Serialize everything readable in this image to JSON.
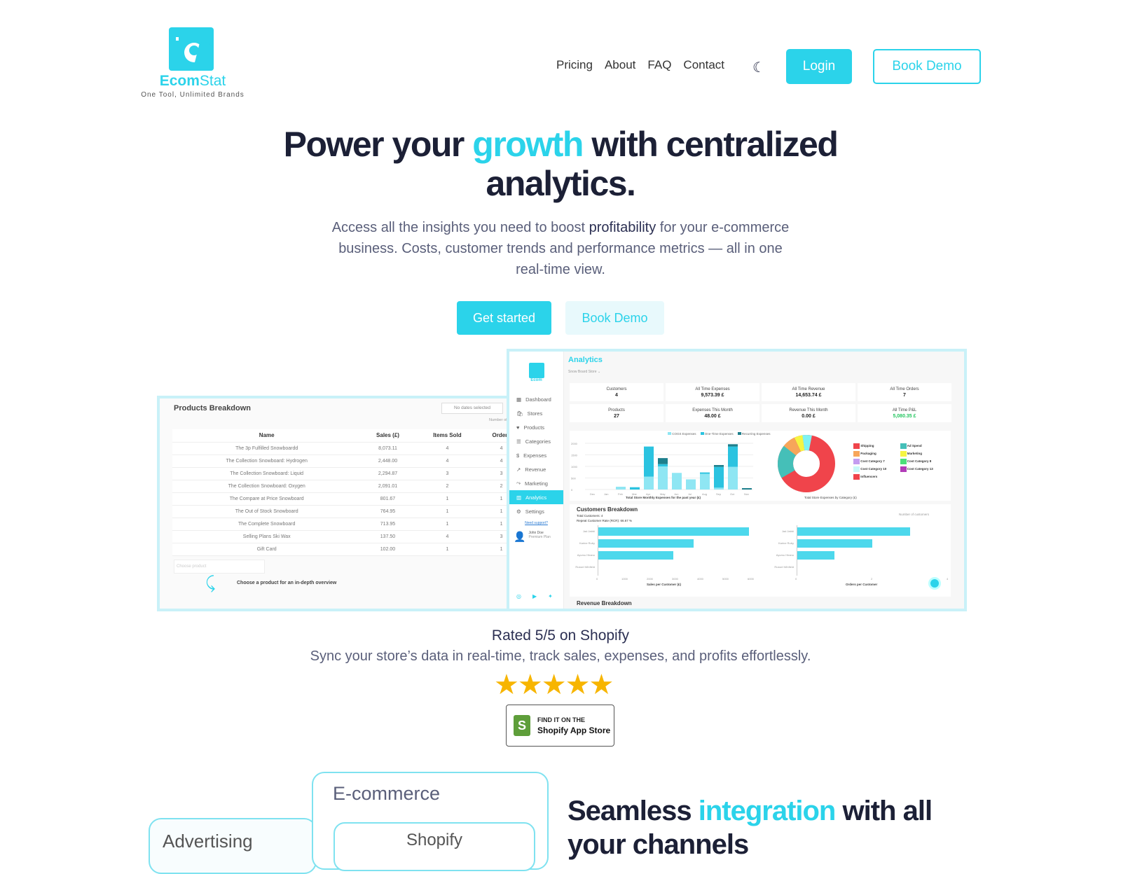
{
  "brand": {
    "name_a": "Ecom",
    "name_b": "Stat",
    "tagline": "One Tool, Unlimited Brands"
  },
  "nav": {
    "items": [
      "Pricing",
      "About",
      "FAQ",
      "Contact"
    ],
    "theme_icon": "moon-icon",
    "login": "Login",
    "book_demo": "Book Demo"
  },
  "hero": {
    "title_a": "Power your ",
    "title_accent": "growth",
    "title_b": " with centralized analytics.",
    "lead_a": "Access all the insights you need to boost ",
    "lead_bold": "profitability",
    "lead_b": " for your e-commerce business. Costs, customer trends and performance metrics — all in one real-time view.",
    "cta_primary": "Get started",
    "cta_secondary": "Book Demo"
  },
  "products": {
    "title": "Products Breakdown",
    "date_filter": "No dates selected",
    "number_of": "Number of",
    "columns": [
      "Name",
      "Sales (£)",
      "Items Sold",
      "Orders"
    ],
    "rows": [
      [
        "The 3p Fulfilled Snowboardd",
        "8,073.11",
        "4",
        "4"
      ],
      [
        "The Collection Snowboard: Hydrogen",
        "2,448.00",
        "4",
        "4"
      ],
      [
        "The Collection Snowboard: Liquid",
        "2,294.87",
        "3",
        "3"
      ],
      [
        "The Collection Snowboard: Oxygen",
        "2,091.01",
        "2",
        "2"
      ],
      [
        "The Compare at Price Snowboard",
        "801.67",
        "1",
        "1"
      ],
      [
        "The Out of Stock Snowboard",
        "764.95",
        "1",
        "1"
      ],
      [
        "The Complete Snowboard",
        "713.95",
        "1",
        "1"
      ],
      [
        "Selling Plans Ski Wax",
        "137.50",
        "4",
        "3"
      ],
      [
        "Gift Card",
        "102.00",
        "1",
        "1"
      ]
    ],
    "choose_placeholder": "Choose product",
    "hint": "Choose a product for an in-depth overview"
  },
  "analytics": {
    "title": "Analytics",
    "store": "Snow Board Store",
    "sidebar": [
      "Dashboard",
      "Stores",
      "Products",
      "Categories",
      "Expenses",
      "Revenue",
      "Marketing",
      "Analytics",
      "Settings"
    ],
    "support": "Need support?",
    "user": "John Doe",
    "user_role": "Premium Plan",
    "cards": [
      [
        "Customers",
        "4"
      ],
      [
        "All Time Expenses",
        "9,573.39 £"
      ],
      [
        "All Time Revenue",
        "14,653.74 £"
      ],
      [
        "All Time Orders",
        "7"
      ],
      [
        "Products",
        "27"
      ],
      [
        "Expenses This Month",
        "48.00 £"
      ],
      [
        "Revenue This Month",
        "0.00 £"
      ],
      [
        "All Time P&L",
        "5,080.35 £"
      ]
    ],
    "pnl_color": "#22c55e",
    "bar_legend": [
      "COGS Expenses",
      "One-Time Expenses",
      "Recurring Expenses"
    ],
    "bar_caption": "Total Store Monthly Expenses for the past year (£)",
    "months": [
      "Dec",
      "Jan",
      "Feb",
      "Mar",
      "Apr",
      "May",
      "Jun",
      "Jul",
      "Aug",
      "Sep",
      "Oct",
      "Nov"
    ],
    "cogs": [
      0,
      0,
      120,
      0,
      560,
      1000,
      720,
      440,
      680,
      80,
      980,
      0
    ],
    "onetime": [
      0,
      0,
      0,
      100,
      1300,
      100,
      0,
      0,
      60,
      900,
      880,
      0
    ],
    "recurring": [
      0,
      0,
      0,
      0,
      0,
      260,
      0,
      0,
      0,
      80,
      100,
      60
    ],
    "donut_caption": "Total Store Expenses by Category (£)",
    "donut_legend": [
      [
        "Shipping",
        "#f0444b"
      ],
      [
        "Ad Spend",
        "#45bfb8"
      ],
      [
        "Packaging",
        "#f7a65a"
      ],
      [
        "Marketing",
        "#f5f542"
      ],
      [
        "Cost Category 7",
        "#c49cf0"
      ],
      [
        "Cost Category 8",
        "#4be07a"
      ],
      [
        "Cost Category 10",
        "#c9f8f8"
      ],
      [
        "Cost Category 13",
        "#b23cb8"
      ],
      [
        "Influencers",
        "#f0444b"
      ]
    ],
    "customers_title": "Customers Breakdown",
    "total_customers": "Total Customers: 4",
    "rcr": "Repeat Customer Rate (RCR): 66.67 %",
    "sort_label": "Number of customers",
    "customer_names": [
      "Jad Jabbi",
      "Karine Ruby",
      "Ayumu Hirano",
      "Russel Winfield"
    ],
    "sales_per_customer": [
      6000,
      3800,
      3000,
      0
    ],
    "sales_axis": "Sales per Customer (£)",
    "orders_per_customer": [
      3,
      2,
      1,
      0
    ],
    "orders_axis": "Orders per Customer",
    "revenue_title": "Revenue Breakdown"
  },
  "rating": {
    "title": "Rated 5/5 on Shopify",
    "subtitle": "Sync your store’s data in real-time, track sales, expenses, and profits effortlessly.",
    "stars": 5,
    "badge_top": "FIND IT ON THE",
    "badge_bottom": "Shopify App Store"
  },
  "integrations": {
    "card_ecommerce": "E-commerce",
    "card_advertising": "Advertising",
    "card_shopify": "Shopify",
    "title_a": "Seamless ",
    "title_accent": "integration",
    "title_b": " with all your channels"
  },
  "colors": {
    "accent": "#2bd3ea",
    "dark": "#1c2036"
  }
}
